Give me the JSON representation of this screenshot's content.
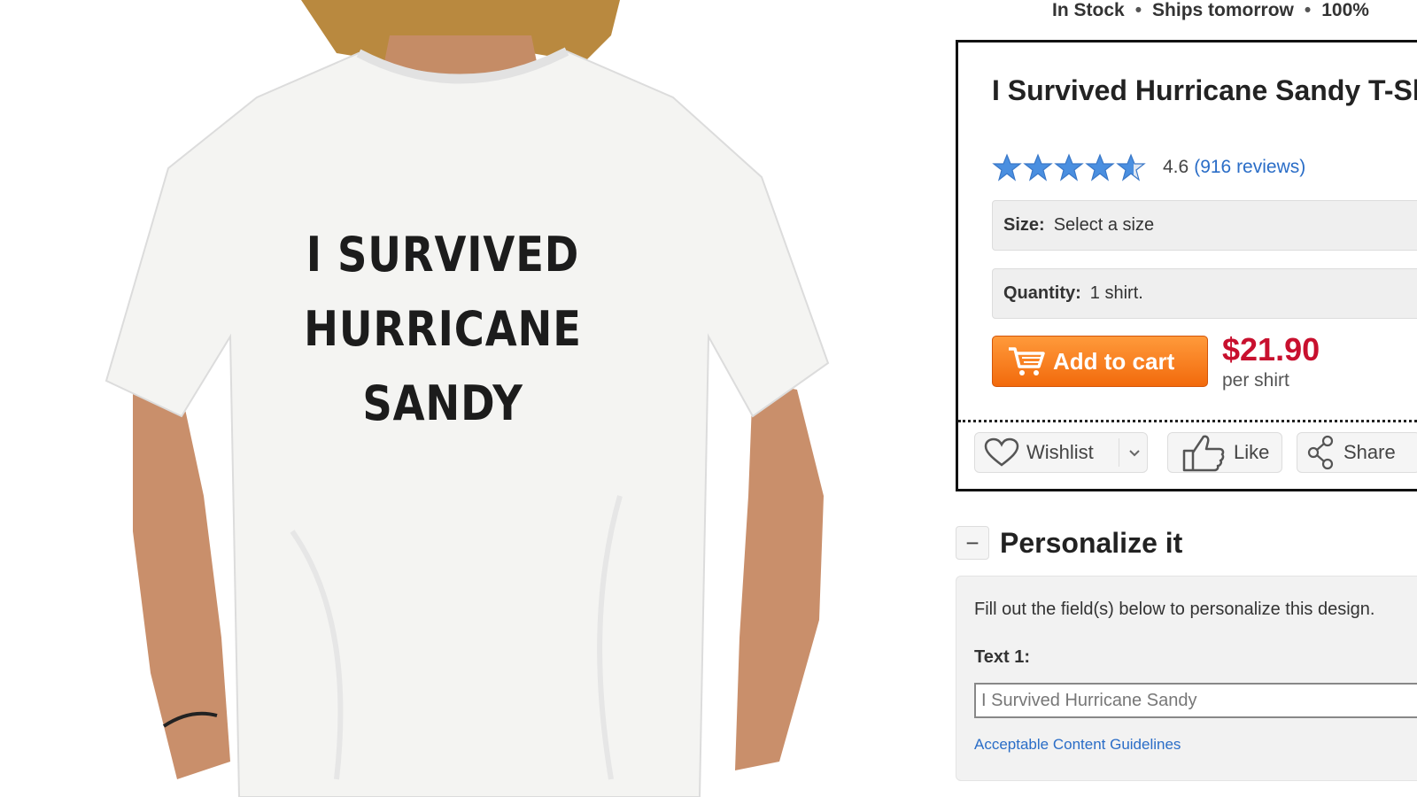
{
  "product_image": {
    "shirt_text": [
      "I SURVIVED",
      "HURRICANE",
      "SANDY"
    ]
  },
  "status": {
    "stock": "In Stock",
    "shipping": "Ships tomorrow",
    "guarantee": "100%"
  },
  "product": {
    "title": "I Survived Hurricane Sandy T-Shirts",
    "rating_value": "4.6",
    "rating_fraction": 0.92,
    "reviews_label": "(916 reviews)",
    "size_label": "Size:",
    "size_value": "Select a size",
    "quantity_label": "Quantity:",
    "quantity_value": "1 shirt.",
    "add_to_cart_label": "Add to cart",
    "price": "$21.90",
    "price_unit": "per shirt"
  },
  "social": {
    "wishlist_label": "Wishlist",
    "like_label": "Like",
    "share_label": "Share"
  },
  "personalize": {
    "toggle_symbol": "−",
    "title": "Personalize it",
    "description": "Fill out the field(s) below to personalize this design.",
    "text1_label": "Text 1:",
    "text1_value": "I Survived Hurricane Sandy",
    "guidelines_link": "Acceptable Content Guidelines"
  },
  "colors": {
    "accent_orange": "#f26a0c",
    "price_red": "#c8102e",
    "link_blue": "#2a6dc7",
    "star_blue": "#4a8fe0"
  },
  "icons": [
    "star-icon",
    "cart-icon",
    "heart-icon",
    "chevron-down-icon",
    "thumbs-up-icon",
    "share-icon",
    "minus-icon"
  ]
}
